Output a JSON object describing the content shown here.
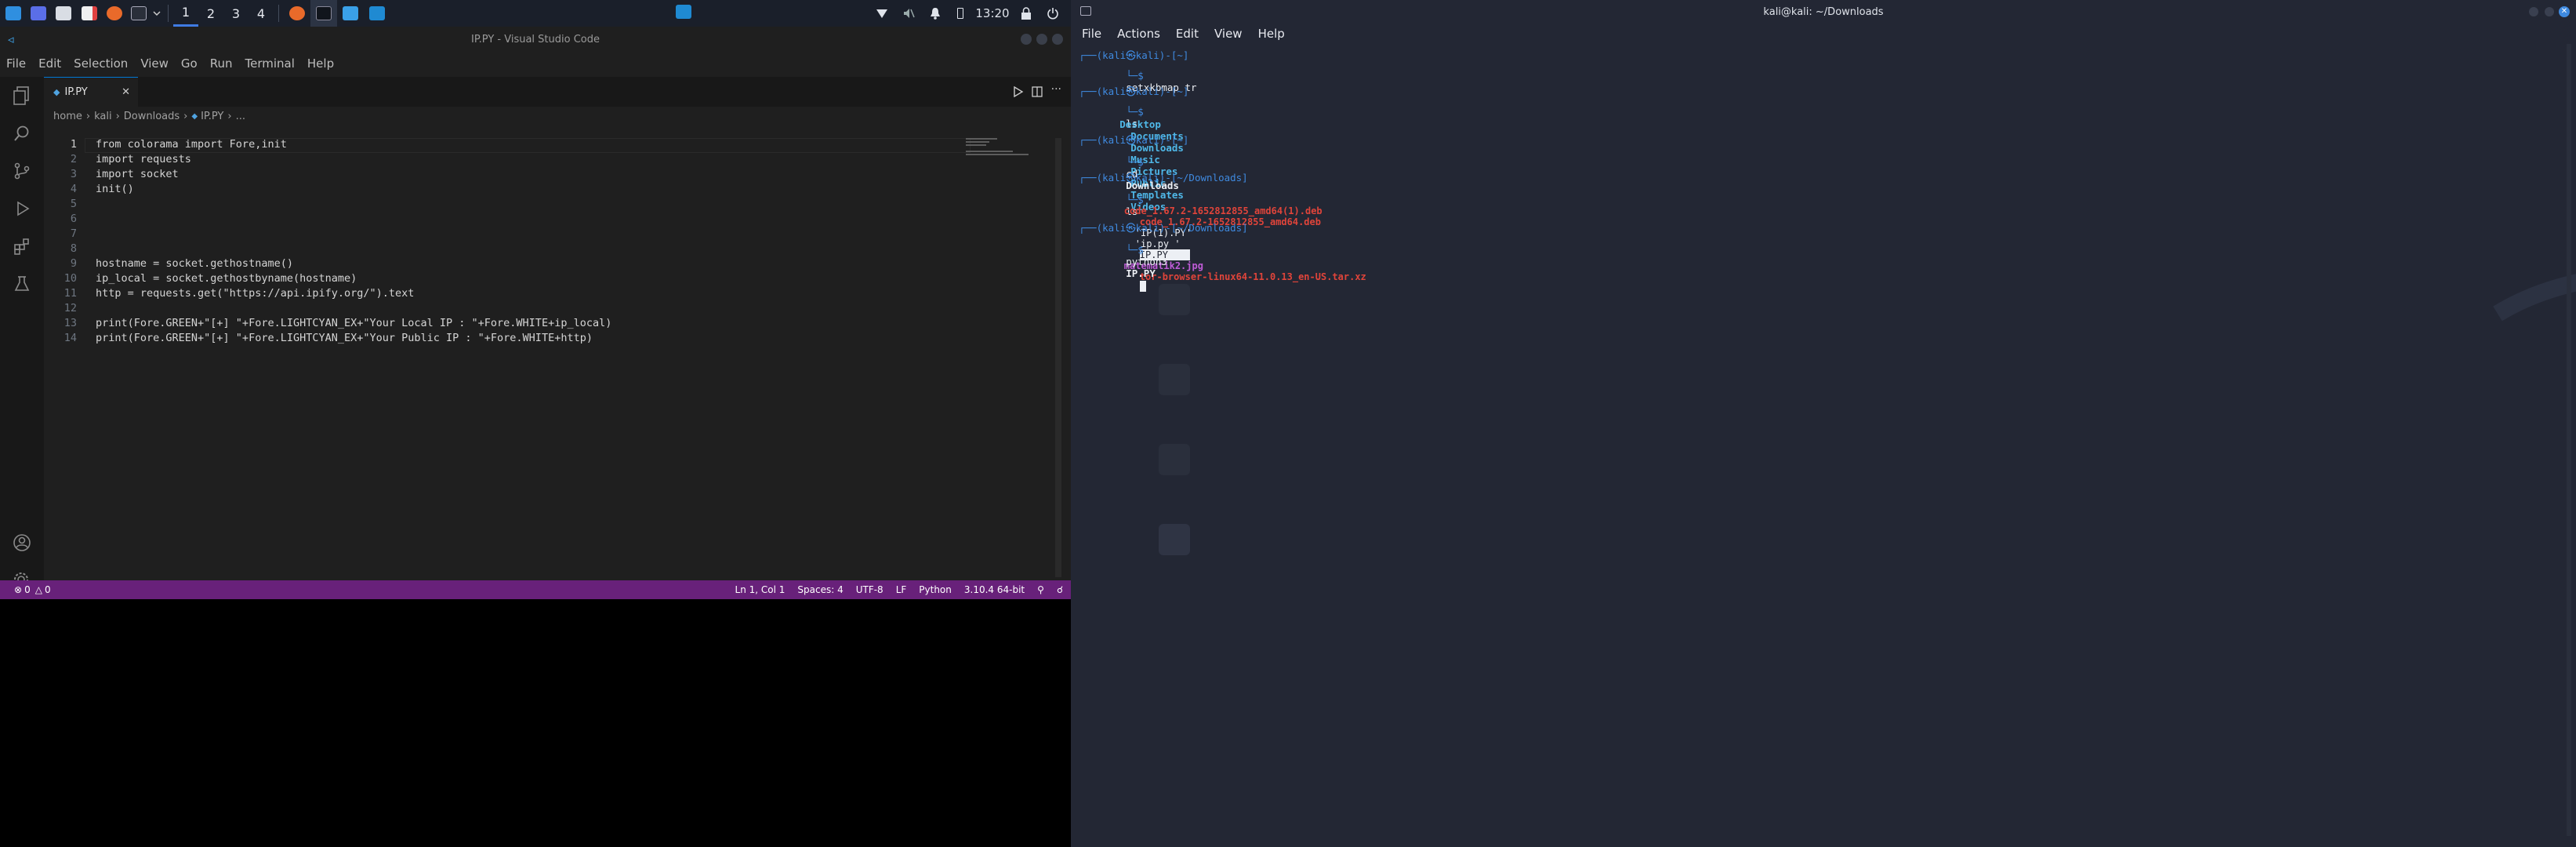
{
  "panel": {
    "workspaces": [
      "1",
      "2",
      "3",
      "4"
    ],
    "clock": "13:20"
  },
  "vscode": {
    "window_title": "IP.PY - Visual Studio Code",
    "menu": [
      "File",
      "Edit",
      "Selection",
      "View",
      "Go",
      "Run",
      "Terminal",
      "Help"
    ],
    "tab_label": "IP.PY",
    "breadcrumb": [
      "home",
      "kali",
      "Downloads",
      "IP.PY",
      "..."
    ],
    "line_numbers": [
      "1",
      "2",
      "3",
      "4",
      "5",
      "6",
      "7",
      "8",
      "9",
      "10",
      "11",
      "12",
      "13",
      "14"
    ],
    "code_lines": [
      "from colorama import Fore,init",
      "import requests",
      "import socket",
      "init()",
      "",
      "",
      "",
      "",
      "hostname = socket.gethostname()",
      "ip_local = socket.gethostbyname(hostname)",
      "http = requests.get(\"https://api.ipify.org/\").text",
      "",
      "print(Fore.GREEN+\"[+] \"+Fore.LIGHTCYAN_EX+\"Your Local IP : \"+Fore.WHITE+ip_local)",
      "print(Fore.GREEN+\"[+] \"+Fore.LIGHTCYAN_EX+\"Your Public IP : \"+Fore.WHITE+http)"
    ],
    "status": {
      "problems": "0",
      "warnings": "0",
      "position": "Ln 1, Col 1",
      "spaces": "Spaces: 4",
      "encoding": "UTF-8",
      "eol": "LF",
      "language": "Python",
      "interpreter": "3.10.4 64-bit"
    },
    "status_color": "#68217a"
  },
  "terminal": {
    "window_title": "kali@kali: ~/Downloads",
    "menu": [
      "File",
      "Actions",
      "Edit",
      "View",
      "Help"
    ],
    "prompt_home": "┌──(kali㉿kali)-[~]",
    "prompt_downloads": "┌──(kali㉿kali)-[~/Downloads]",
    "prompt_tail": "└─$",
    "cmd1": "setxkbmap tr",
    "cmd2": "ls",
    "ls_home": [
      "Desktop",
      "Documents",
      "Downloads",
      "Music",
      "Pictures",
      "Public",
      "Templates",
      "Videos"
    ],
    "cmd3": "cd",
    "cmd3_arg": "Downloads",
    "cmd4": "ls",
    "ls_downloads": {
      "f1": "code_1.67.2-1652812855_amd64(1).deb",
      "f2": "code_1.67.2-1652812855_amd64.deb",
      "f3": "'IP(1).PY'",
      "f4": "'ip.py '",
      "f5": "IP.PY",
      "f6": "matematik2.jpg",
      "f7": "tor-browser-linux64-11.0.13_en-US.tar.xz"
    },
    "cmd5": "python3",
    "cmd5_arg": "IP.PY"
  }
}
